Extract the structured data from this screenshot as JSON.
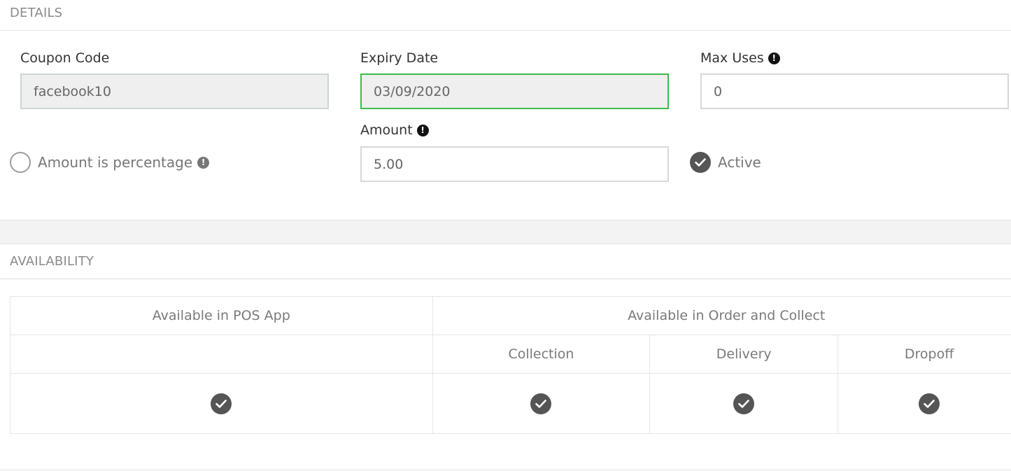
{
  "details": {
    "title": "DETAILS",
    "coupon_code": {
      "label": "Coupon Code",
      "value": "facebook10"
    },
    "expiry_date": {
      "label": "Expiry Date",
      "value": "03/09/2020"
    },
    "max_uses": {
      "label": "Max Uses",
      "value": "0"
    },
    "amount": {
      "label": "Amount",
      "value": "5.00"
    },
    "amount_is_percentage": {
      "label": "Amount is percentage",
      "checked": false
    },
    "active": {
      "label": "Active",
      "checked": true
    }
  },
  "availability": {
    "title": "AVAILABILITY",
    "pos_header": "Available in POS App",
    "order_collect_header": "Available in Order and Collect",
    "sub_headers": [
      "Collection",
      "Delivery",
      "Dropoff"
    ],
    "values": {
      "pos": true,
      "collection": true,
      "delivery": true,
      "dropoff": true
    }
  },
  "icons": {
    "info": "info-icon",
    "check": "check-icon"
  },
  "colors": {
    "focus_border": "#3cbc4a",
    "check_bg": "#555555"
  }
}
